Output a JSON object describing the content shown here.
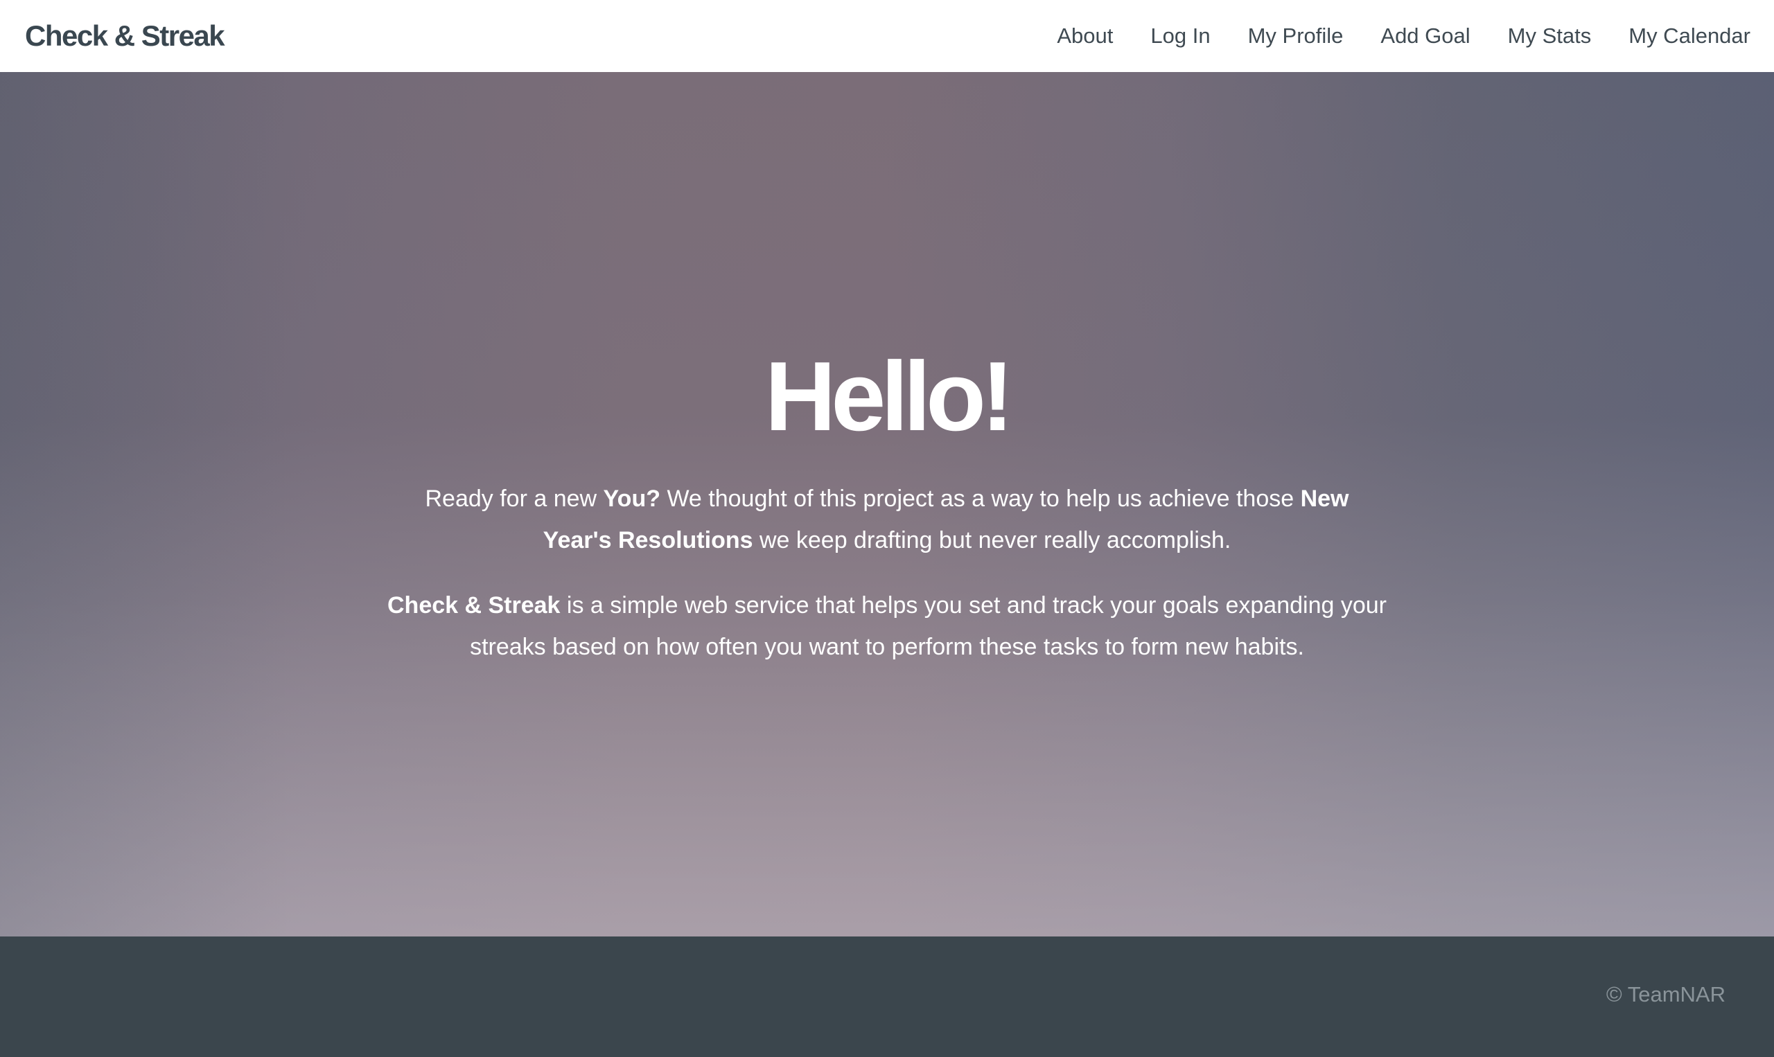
{
  "navbar": {
    "brand": "Check & Streak",
    "links": [
      {
        "label": "About"
      },
      {
        "label": "Log In"
      },
      {
        "label": "My Profile"
      },
      {
        "label": "Add Goal"
      },
      {
        "label": "My Stats"
      },
      {
        "label": "My Calendar"
      }
    ]
  },
  "hero": {
    "title": "Hello!",
    "paragraph1": {
      "part1": "Ready for a new ",
      "bold1": "You?",
      "part2": " We thought of this project as a way to help us achieve those ",
      "bold2": "New Year's Resolutions",
      "part3": " we keep drafting but never really accomplish."
    },
    "paragraph2": {
      "bold1": "Check & Streak",
      "part1": " is a simple web service that helps you set and track your goals expanding your streaks based on how often you want to perform these tasks to form new habits."
    }
  },
  "footer": {
    "copyright": "© TeamNAR"
  },
  "colors": {
    "navbar_bg": "#ffffff",
    "brand_text": "#3a4750",
    "footer_bg": "#3b464d",
    "footer_text": "#8a949a",
    "hero_text": "#ffffff"
  }
}
